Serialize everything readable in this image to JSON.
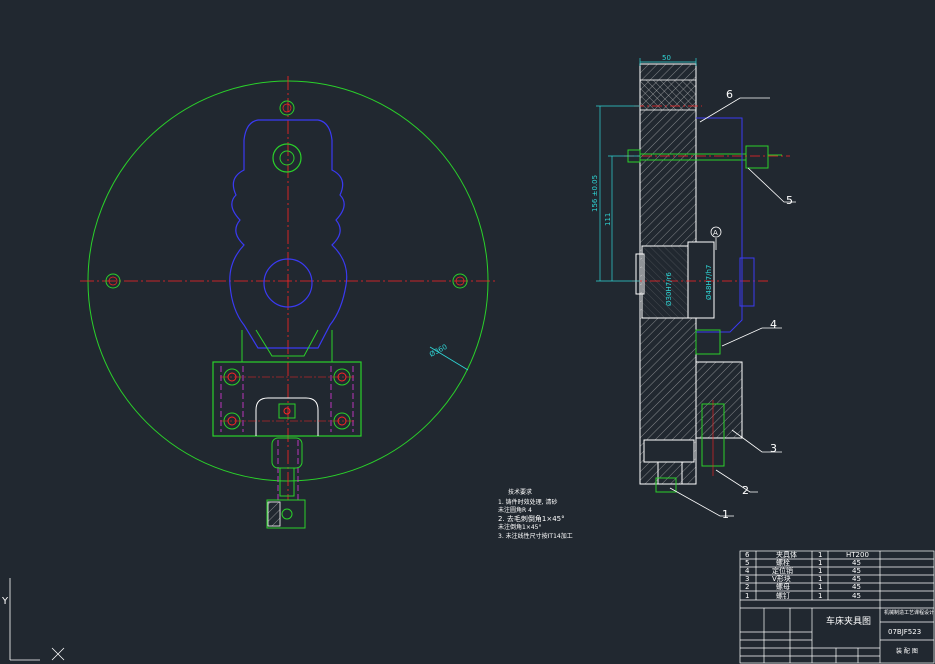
{
  "drawing": {
    "dimensions": {
      "top_width": "50",
      "overall_height": "156 ±0.05",
      "inner_height": "111",
      "diameter": "Ø360",
      "fit_left": "Ø30H7/r6",
      "fit_right": "Ø48H7/h7",
      "datum": "A"
    },
    "balloons": [
      "1",
      "2",
      "3",
      "4",
      "5",
      "6"
    ],
    "notes": {
      "heading": "技术要求",
      "lines": [
        "1. 铸件时效处理, 清砂",
        "   未注圆角R 4",
        "2. 去毛刺倒角1×45°",
        "   未注倒角1×45°",
        "3. 未注线性尺寸按IT14加工"
      ]
    },
    "parts_list": {
      "rows": [
        {
          "no": "6",
          "name": "夹具体",
          "qty": "1",
          "material": "HT200"
        },
        {
          "no": "5",
          "name": "螺栓",
          "qty": "1",
          "material": "45"
        },
        {
          "no": "4",
          "name": "定位销",
          "qty": "1",
          "material": "45"
        },
        {
          "no": "3",
          "name": "V形块",
          "qty": "1",
          "material": "45"
        },
        {
          "no": "2",
          "name": "螺母",
          "qty": "1",
          "material": "45"
        },
        {
          "no": "1",
          "name": "螺钉",
          "qty": "1",
          "material": "45"
        }
      ]
    },
    "title_block": {
      "drawing_name": "车床夹具图",
      "school": "机械制造工艺课程设计",
      "drawing_no": "07BJF523",
      "footer": "装 配 图"
    },
    "ucs": {
      "axis_label": "Y"
    },
    "colors": {
      "background": "#212830",
      "outline_green": "#2ad12a",
      "part_blue": "#3a3af2",
      "centerline_red": "#ff2424",
      "dim_cyan": "#2fd6d6",
      "hidden_magenta": "#e03ae0",
      "text_white": "#ffffff"
    }
  }
}
